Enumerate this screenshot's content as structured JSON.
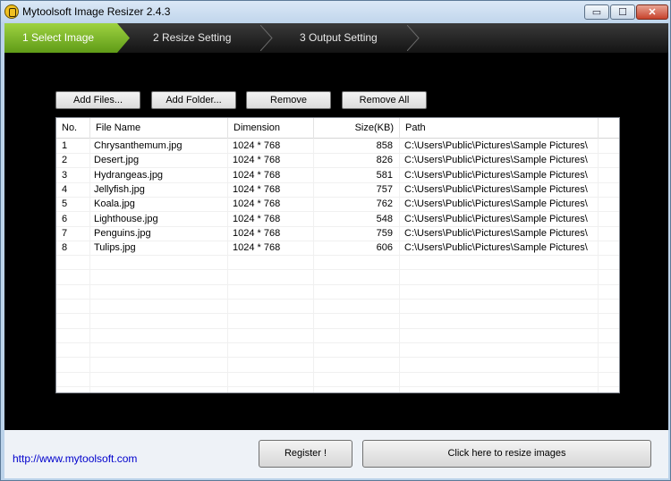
{
  "window": {
    "title": "Mytoolsoft Image Resizer 2.4.3",
    "controls": {
      "minimize": "▭",
      "maximize": "☐",
      "close": "✕"
    }
  },
  "steps": [
    {
      "label": "1 Select Image",
      "active": true
    },
    {
      "label": "2 Resize Setting",
      "active": false
    },
    {
      "label": "3 Output Setting",
      "active": false
    }
  ],
  "toolbar": {
    "add_files": "Add Files...",
    "add_folder": "Add Folder...",
    "remove": "Remove",
    "remove_all": "Remove All"
  },
  "table": {
    "columns": [
      "No.",
      "File Name",
      "Dimension",
      "Size(KB)",
      "Path"
    ],
    "rows": [
      [
        "1",
        "Chrysanthemum.jpg",
        "1024 * 768",
        "858",
        "C:\\Users\\Public\\Pictures\\Sample Pictures\\"
      ],
      [
        "2",
        "Desert.jpg",
        "1024 * 768",
        "826",
        "C:\\Users\\Public\\Pictures\\Sample Pictures\\"
      ],
      [
        "3",
        "Hydrangeas.jpg",
        "1024 * 768",
        "581",
        "C:\\Users\\Public\\Pictures\\Sample Pictures\\"
      ],
      [
        "4",
        "Jellyfish.jpg",
        "1024 * 768",
        "757",
        "C:\\Users\\Public\\Pictures\\Sample Pictures\\"
      ],
      [
        "5",
        "Koala.jpg",
        "1024 * 768",
        "762",
        "C:\\Users\\Public\\Pictures\\Sample Pictures\\"
      ],
      [
        "6",
        "Lighthouse.jpg",
        "1024 * 768",
        "548",
        "C:\\Users\\Public\\Pictures\\Sample Pictures\\"
      ],
      [
        "7",
        "Penguins.jpg",
        "1024 * 768",
        "759",
        "C:\\Users\\Public\\Pictures\\Sample Pictures\\"
      ],
      [
        "8",
        "Tulips.jpg",
        "1024 * 768",
        "606",
        "C:\\Users\\Public\\Pictures\\Sample Pictures\\"
      ]
    ]
  },
  "footer": {
    "link": "http://www.mytoolsoft.com",
    "register": "Register !",
    "resize": "Click here to resize images"
  },
  "colors": {
    "accent_step": "#7cb82f",
    "link": "#0000cc"
  }
}
